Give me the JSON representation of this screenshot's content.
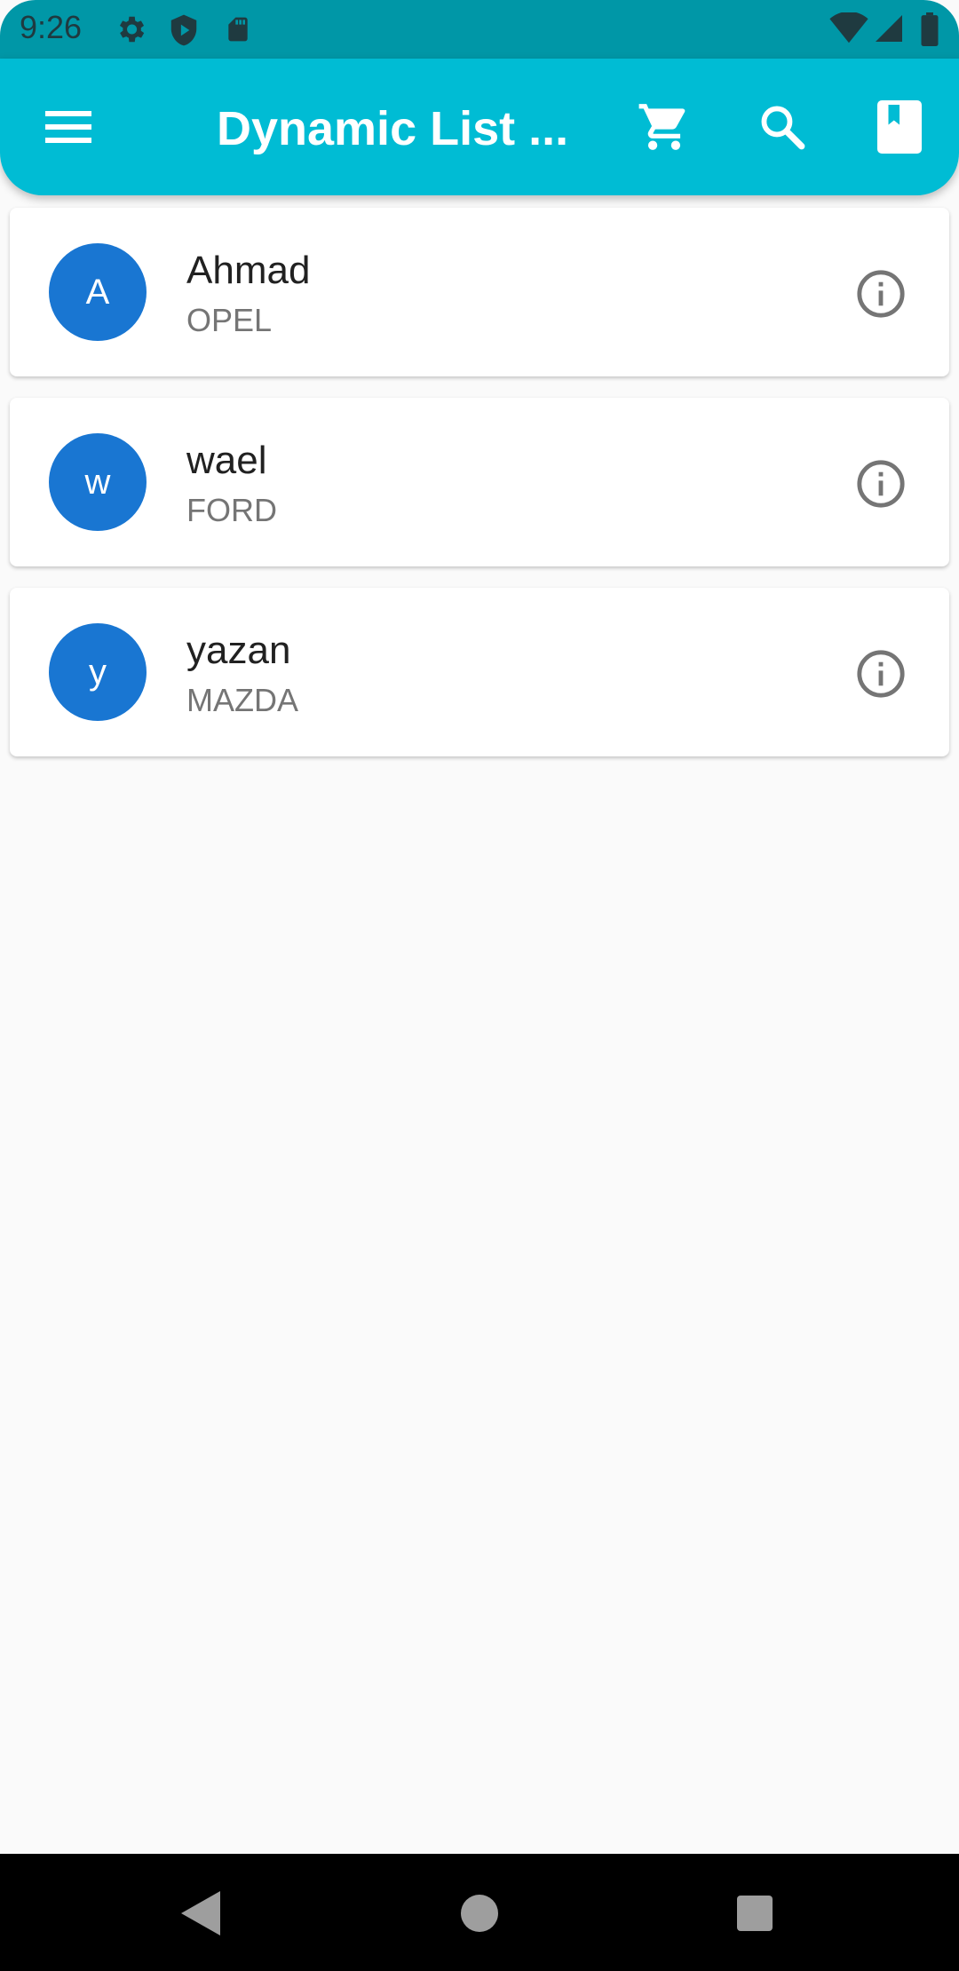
{
  "status_bar": {
    "time": "9:26",
    "icons_left": [
      "settings-icon",
      "play-protect-icon",
      "sd-card-icon"
    ],
    "icons_right": [
      "wifi-icon",
      "signal-icon",
      "battery-icon"
    ]
  },
  "app_bar": {
    "title": "Dynamic List ...",
    "actions": [
      "menu-icon",
      "cart-icon",
      "search-icon",
      "bookmark-icon"
    ],
    "color": "#00bcd4"
  },
  "list": {
    "items": [
      {
        "initial": "A",
        "name": "Ahmad",
        "brand": "OPEL"
      },
      {
        "initial": "w",
        "name": "wael",
        "brand": "FORD"
      },
      {
        "initial": "y",
        "name": "yazan",
        "brand": "MAZDA"
      }
    ],
    "avatar_color": "#1976d2"
  },
  "nav_bar": {
    "buttons": [
      "back-icon",
      "home-icon",
      "recents-icon"
    ]
  }
}
